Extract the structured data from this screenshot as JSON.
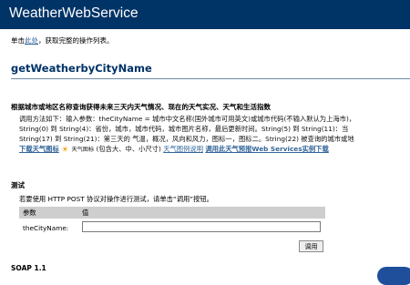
{
  "header": {
    "title": "WeatherWebService"
  },
  "intro": {
    "prefix": "单击",
    "link": "此处",
    "suffix": "，获取完整的操作列表。"
  },
  "operation": {
    "name": "getWeatherbyCityName"
  },
  "description": {
    "heading": "根据城市或地区名称查询获得未来三天内天气情况、现在的天气实况、天气和生活指数",
    "line1": "调用方法如下：输入参数：theCityName = 城市中文名称(国外城市可用英文)或城市代码(不输入默认为上海市)，",
    "line2": "String(0) 到 String(4)：省份，城市，城市代码，城市图片名称，最后更新时间。String(5) 到 String(11)：当",
    "line3": "String(17) 到 String(21)：第三天的 气温，概况，风向和风力，图标一，图标二。String(22) 被查询的城市或地",
    "line4": {
      "link1": "下载天气图标",
      "icon_label": "天气图标",
      "size_note": "(包含大、中、小尺寸)",
      "link2": "天气图例说明",
      "link3": "调用此天气预报Web Services实例下载"
    }
  },
  "test": {
    "heading": "测试",
    "note": "若要使用 HTTP POST 协议对操作进行测试，请单击“调用”按钮。",
    "table": {
      "col_param": "参数",
      "col_value": "值",
      "param_name": "theCityName:",
      "input_value": ""
    },
    "submit_label": "调用"
  },
  "soap": {
    "heading": "SOAP 1.1"
  }
}
